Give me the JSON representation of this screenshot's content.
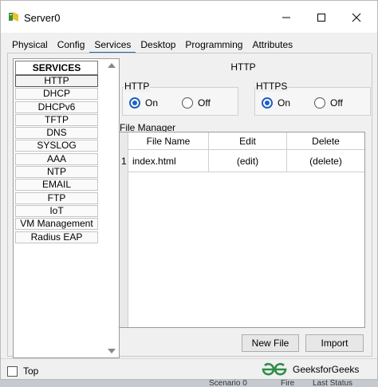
{
  "window": {
    "title": "Server0",
    "tabs": [
      "Physical",
      "Config",
      "Services",
      "Desktop",
      "Programming",
      "Attributes"
    ],
    "active_tab": "Services"
  },
  "services": {
    "header": "SERVICES",
    "items": [
      "HTTP",
      "DHCP",
      "DHCPv6",
      "TFTP",
      "DNS",
      "SYSLOG",
      "AAA",
      "NTP",
      "EMAIL",
      "FTP",
      "IoT",
      "VM Management",
      "Radius EAP"
    ],
    "selected": "HTTP"
  },
  "http_panel": {
    "title": "HTTP",
    "http_group": {
      "label": "HTTP",
      "on": "On",
      "off": "Off",
      "selected": "On"
    },
    "https_group": {
      "label": "HTTPS",
      "on": "On",
      "off": "Off",
      "selected": "On"
    },
    "file_manager": {
      "label": "File Manager",
      "columns": [
        "File Name",
        "Edit",
        "Delete"
      ],
      "rows": [
        {
          "num": "1",
          "file": "index.html",
          "edit": "(edit)",
          "delete": "(delete)"
        }
      ]
    },
    "buttons": {
      "new_file": "New File",
      "import": "Import"
    }
  },
  "footer": {
    "top_label": "Top",
    "brand": "GeeksforGeeks"
  },
  "background": {
    "items": [
      "Scenario 0",
      "Fire",
      "Last Status"
    ]
  },
  "colors": {
    "accent": "#1f5fbf",
    "brand_green": "#2f8d46"
  }
}
